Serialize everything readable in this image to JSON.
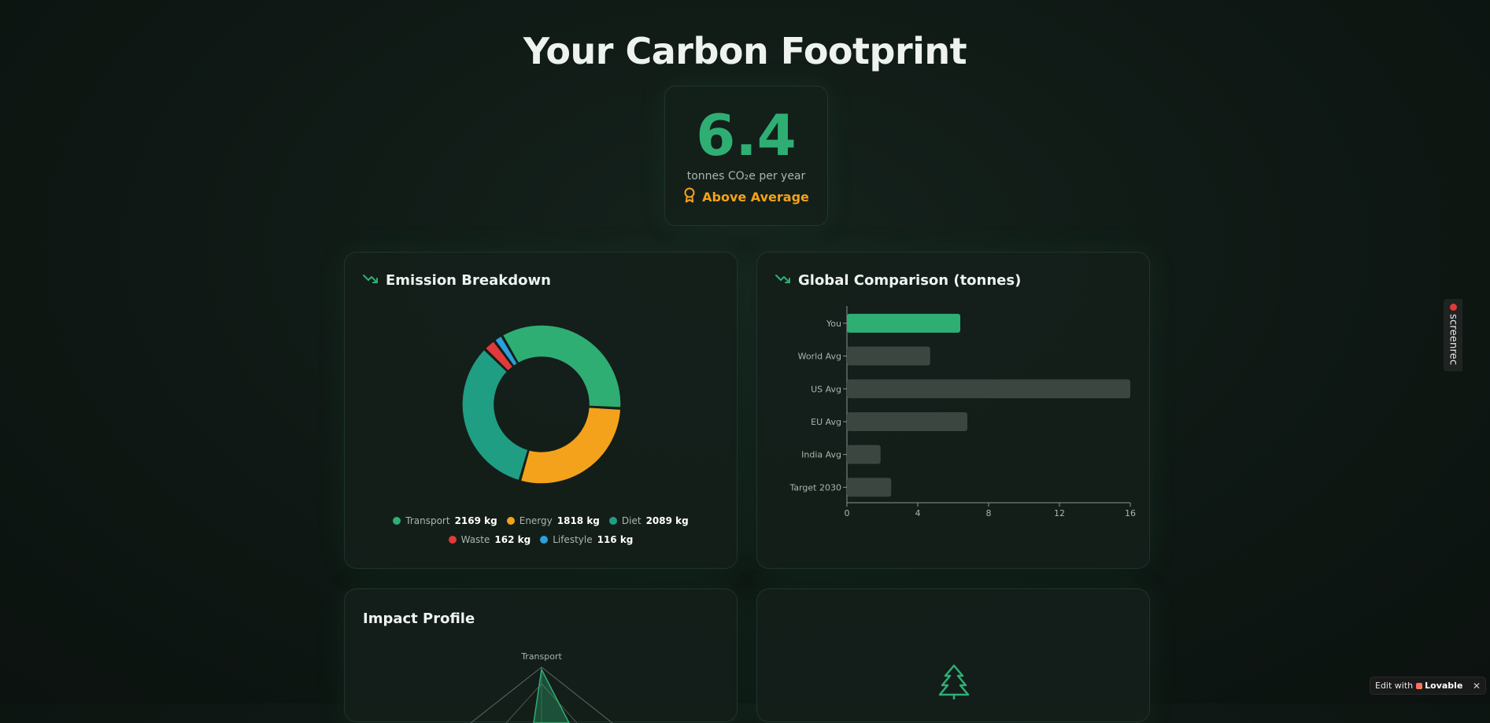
{
  "header": {
    "title": "Your Carbon Footprint"
  },
  "score": {
    "value": "6.4",
    "unit": "tonnes CO₂e per year",
    "rating": "Above Average",
    "value_color": "#2fae74",
    "rating_color": "#f4a21b"
  },
  "breakdown": {
    "title": "Emission Breakdown",
    "legend": [
      {
        "name": "Transport",
        "value": "2169 kg",
        "color": "#2fae74"
      },
      {
        "name": "Energy",
        "value": "1818 kg",
        "color": "#f4a21b"
      },
      {
        "name": "Diet",
        "value": "2089 kg",
        "color": "#1f9e84"
      },
      {
        "name": "Waste",
        "value": "162 kg",
        "color": "#e03a3a"
      },
      {
        "name": "Lifestyle",
        "value": "116 kg",
        "color": "#2d9fdc"
      }
    ]
  },
  "comparison": {
    "title": "Global Comparison (tonnes)"
  },
  "impact": {
    "title": "Impact Profile",
    "axis_label": "Transport"
  },
  "overlays": {
    "screenrec_label": "screenrec",
    "lovable_prefix": "Edit with",
    "lovable_brand": "Lovable",
    "lovable_close": "✕"
  },
  "chart_data": [
    {
      "type": "pie",
      "title": "Emission Breakdown",
      "categories": [
        "Transport",
        "Energy",
        "Diet",
        "Waste",
        "Lifestyle"
      ],
      "values": [
        2169,
        1818,
        2089,
        162,
        116
      ],
      "colors": [
        "#2fae74",
        "#f4a21b",
        "#1f9e84",
        "#e03a3a",
        "#2d9fdc"
      ],
      "unit": "kg",
      "legend": "bottom"
    },
    {
      "type": "bar",
      "orientation": "horizontal",
      "title": "Global Comparison (tonnes)",
      "categories": [
        "You",
        "World Avg",
        "US Avg",
        "EU Avg",
        "India Avg",
        "Target 2030"
      ],
      "values": [
        6.4,
        4.7,
        16,
        6.8,
        1.9,
        2.5
      ],
      "colors": [
        "#2fae74",
        "#3a463f",
        "#3a463f",
        "#3a463f",
        "#3a463f",
        "#3a463f"
      ],
      "xlim": [
        0,
        16
      ],
      "xticks": [
        0,
        4,
        8,
        12,
        16
      ]
    }
  ]
}
